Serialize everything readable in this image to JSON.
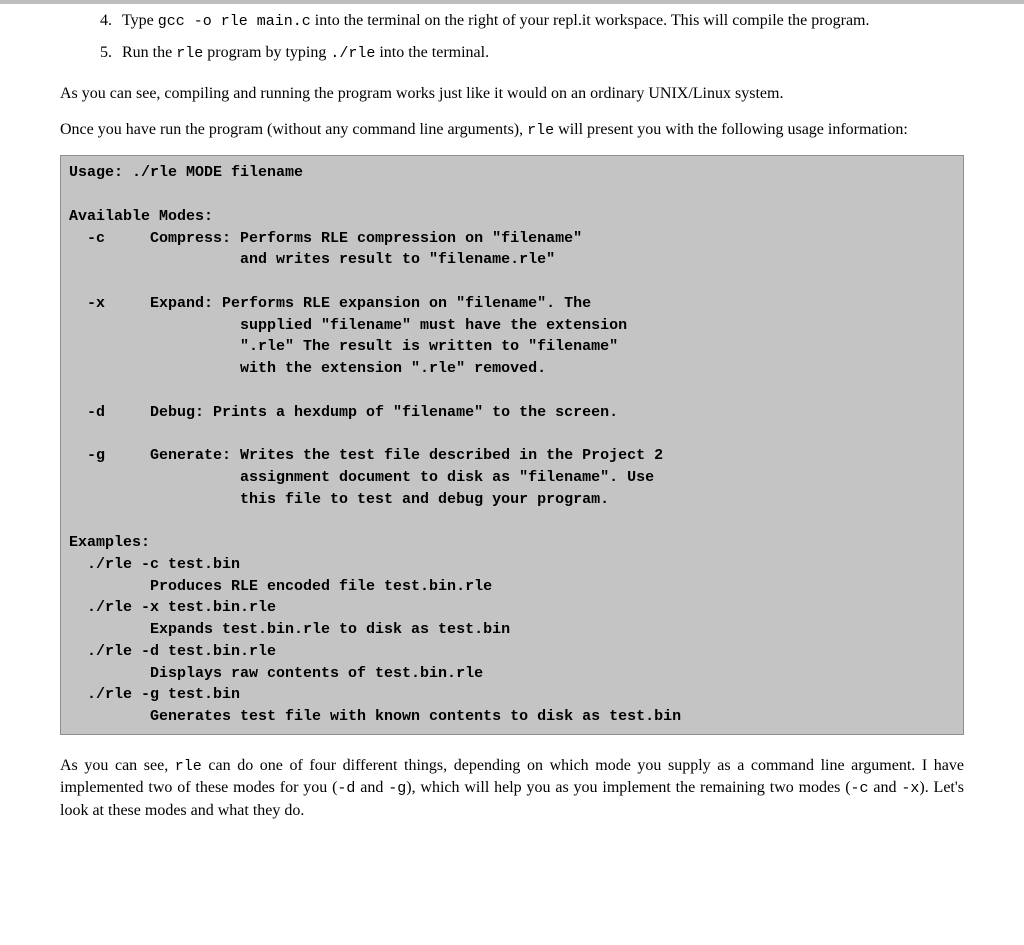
{
  "steps": [
    {
      "num": "4.",
      "pre": "Type ",
      "code": "gcc -o rle main.c",
      "post": " into the terminal on the right of your repl.it workspace. This will compile the program."
    },
    {
      "num": "5.",
      "pre": "Run the ",
      "code": "rle",
      "mid": " program by typing ",
      "code2": "./rle",
      "post": " into the terminal."
    }
  ],
  "para1": {
    "text": "As you can see, compiling and running the program works just like it would on an ordinary UNIX/Linux system."
  },
  "para2": {
    "pre": "Once you have run the program (without any command line arguments), ",
    "code": "rle",
    "post": " will present you with the following usage information:"
  },
  "usage": "Usage: ./rle MODE filename\n\nAvailable Modes:\n  -c     Compress: Performs RLE compression on \"filename\"\n                   and writes result to \"filename.rle\"\n\n  -x     Expand: Performs RLE expansion on \"filename\". The\n                   supplied \"filename\" must have the extension\n                   \".rle\" The result is written to \"filename\"\n                   with the extension \".rle\" removed.\n\n  -d     Debug: Prints a hexdump of \"filename\" to the screen.\n\n  -g     Generate: Writes the test file described in the Project 2\n                   assignment document to disk as \"filename\". Use\n                   this file to test and debug your program.\n\nExamples:\n  ./rle -c test.bin\n         Produces RLE encoded file test.bin.rle\n  ./rle -x test.bin.rle\n         Expands test.bin.rle to disk as test.bin\n  ./rle -d test.bin.rle\n         Displays raw contents of test.bin.rle\n  ./rle -g test.bin\n         Generates test file with known contents to disk as test.bin",
  "para3": {
    "seg1": "As you can see, ",
    "code1": "rle",
    "seg2": " can do one of four different things, depending on which mode you supply as a command line argument.  I have implemented two of these modes for you (",
    "code2": "-d",
    "seg3": " and ",
    "code3": "-g",
    "seg4": "), which will help you as you implement the remaining two modes (",
    "code4": "-c",
    "seg5": " and ",
    "code5": "-x",
    "seg6": "). Let's look at these modes and what they do."
  }
}
